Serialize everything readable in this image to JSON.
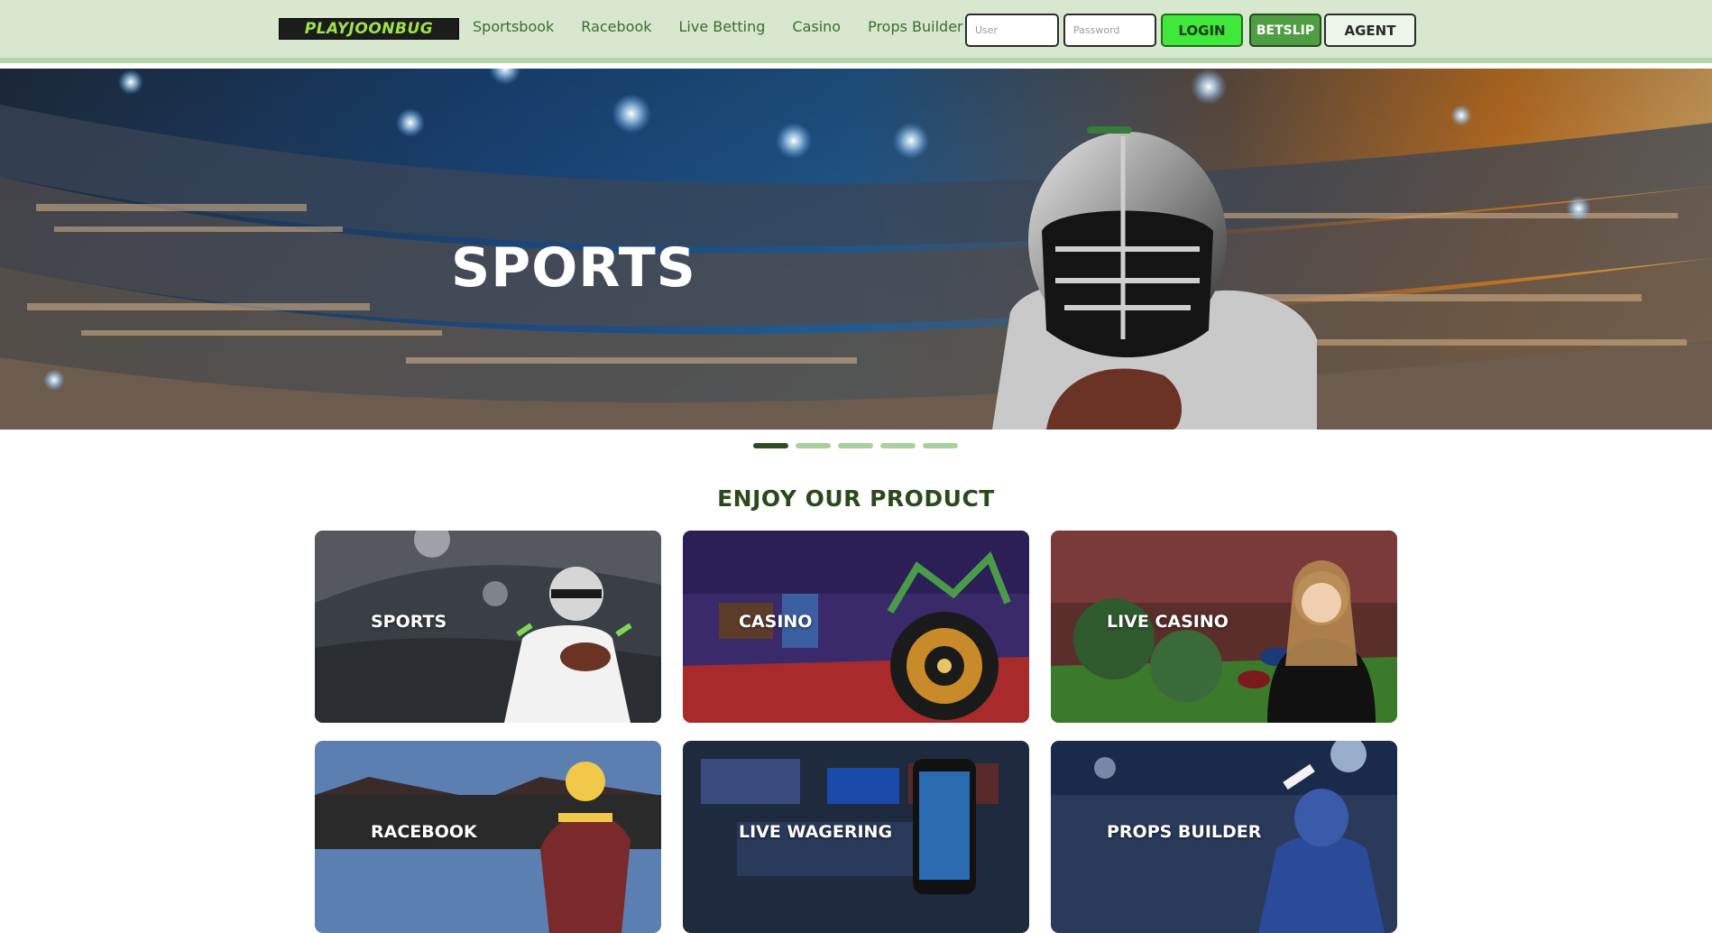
{
  "header": {
    "logo_text": "PLAYJOONBUG",
    "nav": [
      "Sportsbook",
      "Racebook",
      "Live Betting",
      "Casino",
      "Props Builder"
    ],
    "user_placeholder": "User",
    "password_placeholder": "Password",
    "login_label": "LOGIN",
    "betslip_label": "BETSLIP",
    "agent_label": "AGENT"
  },
  "hero": {
    "title": "SPORTS",
    "slides_total": 5,
    "active_slide": 1
  },
  "products": {
    "title": "ENJOY OUR PRODUCT",
    "cards": [
      "SPORTS",
      "CASINO",
      "LIVE CASINO",
      "RACEBOOK",
      "LIVE WAGERING",
      "PROPS BUILDER"
    ]
  },
  "colors": {
    "header_bg": "#d7e8cf",
    "accent_green": "#3fe83a",
    "dark_green": "#2a4a1c",
    "nav_text": "#3f6b31"
  }
}
